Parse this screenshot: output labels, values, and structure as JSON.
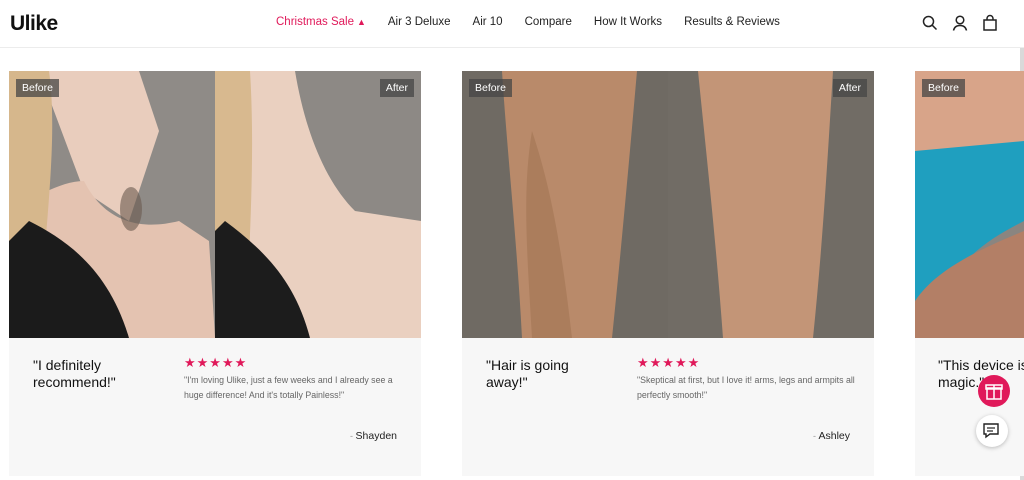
{
  "header": {
    "logo": "Ulike",
    "nav": [
      {
        "label": "Christmas Sale"
      },
      {
        "label": "Air 3 Deluxe"
      },
      {
        "label": "Air 10"
      },
      {
        "label": "Compare"
      },
      {
        "label": "How It Works"
      },
      {
        "label": "Results & Reviews"
      }
    ],
    "icons": [
      "search-icon",
      "account-icon",
      "cart-icon"
    ]
  },
  "accent_color": "#e0195a",
  "cards": [
    {
      "before_label": "Before",
      "after_label": "After",
      "quote": "\"I definitely recommend!\"",
      "stars": "★★★★★",
      "review": "\"I'm loving Ulike, just a few weeks and I already see a huge difference! And it's totally Painless!\"",
      "author": "Shayden"
    },
    {
      "before_label": "Before",
      "after_label": "After",
      "quote": "\"Hair is going away!\"",
      "stars": "★★★★★",
      "review": "\"Skeptical at first, but I love it! arms, legs and armpits all perfectly smooth!\"",
      "author": "Ashley"
    },
    {
      "before_label": "Before",
      "quote": "\"This device is magic.\""
    }
  ]
}
